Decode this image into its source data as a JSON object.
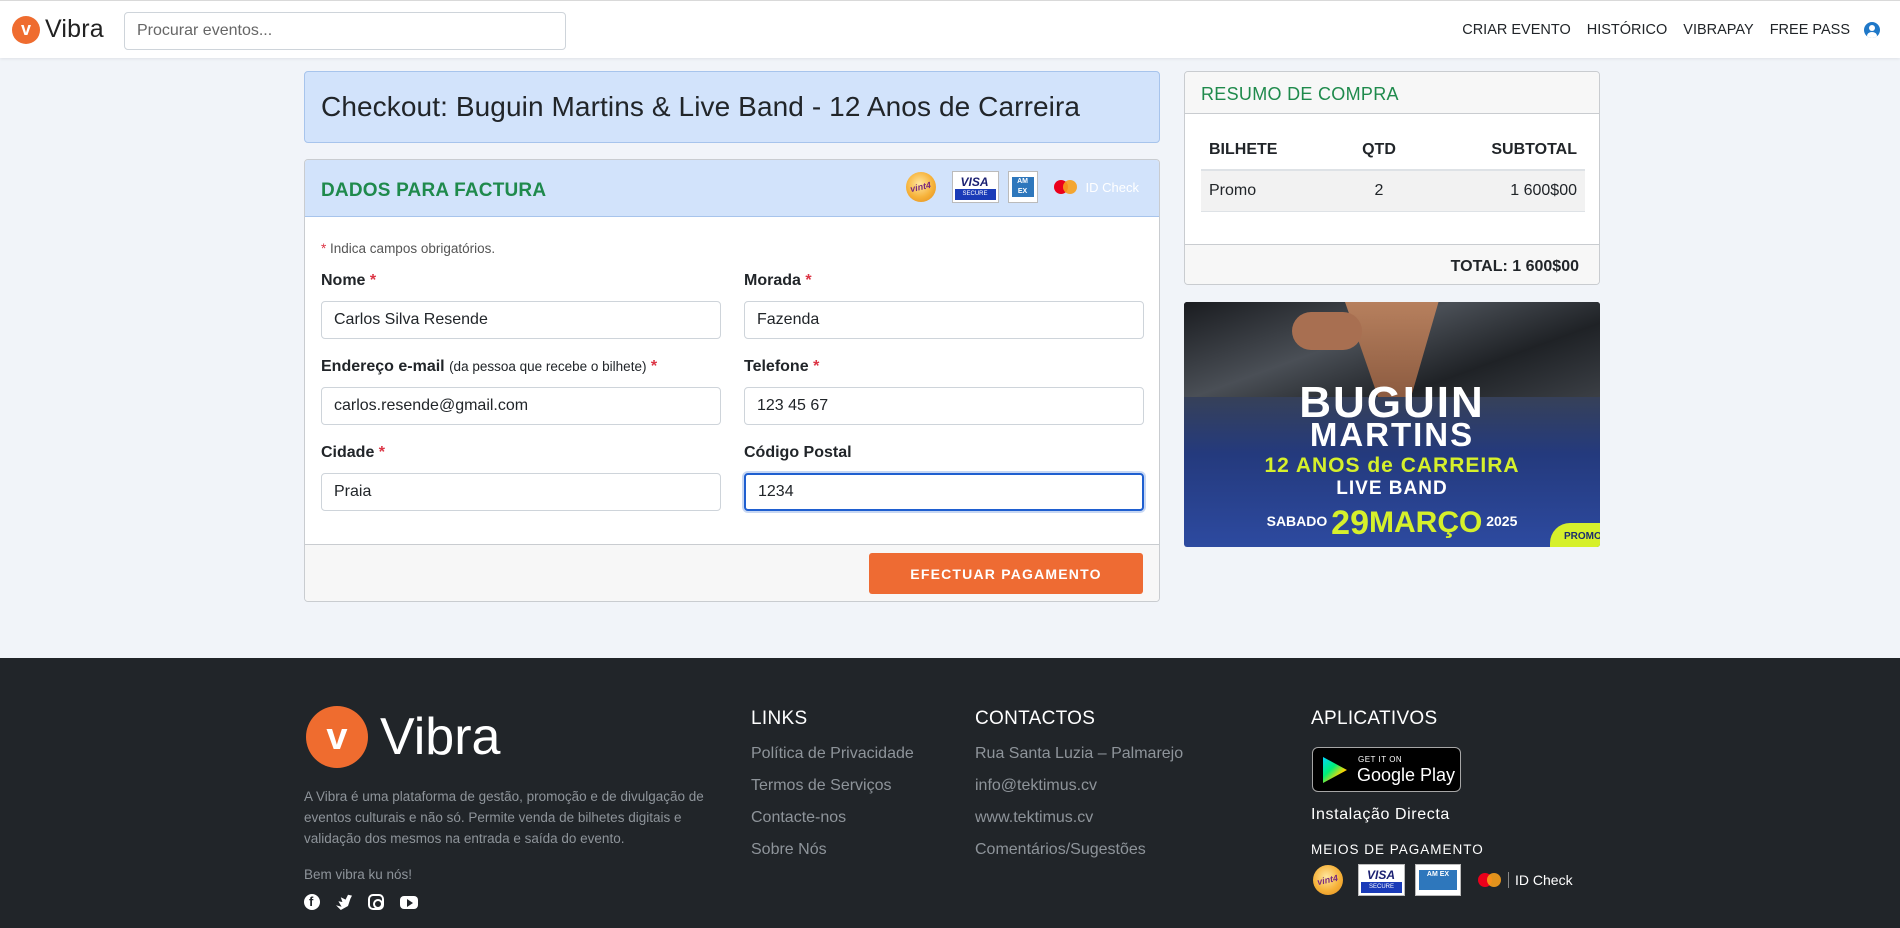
{
  "nav": {
    "brand": "Vibra",
    "brand_initial": "v",
    "search_placeholder": "Procurar eventos...",
    "links": [
      "CRIAR EVENTO",
      "HISTÓRICO",
      "VIBRAPAY",
      "FREE PASS"
    ],
    "user_icon": "user-circle-icon"
  },
  "checkout": {
    "title": "Checkout: Buguin Martins & Live Band - 12 Anos de Carreira"
  },
  "billing": {
    "header": "DADOS PARA FACTURA",
    "payment_logos": {
      "vint4": "vint4",
      "visa": "VISA",
      "visa_secure": "SECURE",
      "amex": "AM EX",
      "idcheck": "ID Check"
    },
    "required_note_star": "*",
    "required_note": "Indica campos obrigatórios.",
    "fields": {
      "nome": {
        "label": "Nome",
        "value": "Carlos Silva Resende"
      },
      "morada": {
        "label": "Morada",
        "value": "Fazenda"
      },
      "email": {
        "label": "Endereço e-mail",
        "hint": "(da pessoa que recebe o bilhete)",
        "value": "carlos.resende@gmail.com"
      },
      "telefone": {
        "label": "Telefone",
        "value": "123 45 67"
      },
      "cidade": {
        "label": "Cidade",
        "value": "Praia"
      },
      "codigo_postal": {
        "label": "Código Postal",
        "value": "1234"
      }
    },
    "submit_label": "EFECTUAR PAGAMENTO"
  },
  "summary": {
    "header": "RESUMO DE COMPRA",
    "columns": [
      "BILHETE",
      "QTD",
      "SUBTOTAL"
    ],
    "rows": [
      {
        "ticket": "Promo",
        "qty": "2",
        "subtotal": "1 600$00"
      }
    ],
    "total": "TOTAL: 1 600$00"
  },
  "poster": {
    "line1": "BUGUIN",
    "line2": "MARTINS",
    "line3": "12 ANOS de CARREIRA",
    "line4": "LIVE BAND",
    "day": "SABADO",
    "date": "29",
    "month": "MARÇO",
    "year": "2025",
    "badge": "PROMO"
  },
  "footer": {
    "brand": "Vibra",
    "brand_initial": "v",
    "description": "A Vibra é uma plataforma de gestão, promoção e de divulgação de eventos culturais e não só. Permite venda de bilhetes digitais e validação dos mesmos na entrada e saída do evento.",
    "tagline": "Bem vibra ku nós!",
    "social_icons": [
      "facebook-icon",
      "twitter-icon",
      "instagram-icon",
      "youtube-icon"
    ],
    "links_title": "LINKS",
    "links": [
      "Política de Privacidade",
      "Termos de Serviços",
      "Contacte-nos",
      "Sobre Nós"
    ],
    "contacts_title": "CONTACTOS",
    "contacts": [
      "Rua Santa Luzia – Palmarejo",
      "info@tektimus.cv",
      "www.tektimus.cv",
      "Comentários/Sugestões"
    ],
    "apps_title": "APLICATIVOS",
    "gplay_small": "GET IT ON",
    "gplay_big": "Google Play",
    "install": "Instalação Directa",
    "meios_title": "MEIOS DE PAGAMENTO",
    "payment_logos": {
      "vint4": "vint4",
      "visa": "VISA",
      "visa_secure": "SECURE",
      "amex": "AM EX",
      "idcheck": "ID Check"
    }
  },
  "colors": {
    "brand_orange": "#ef6c2f",
    "accent_green": "#1f8a4c",
    "header_blue": "#d2e3fb",
    "footer_bg": "#212529"
  }
}
